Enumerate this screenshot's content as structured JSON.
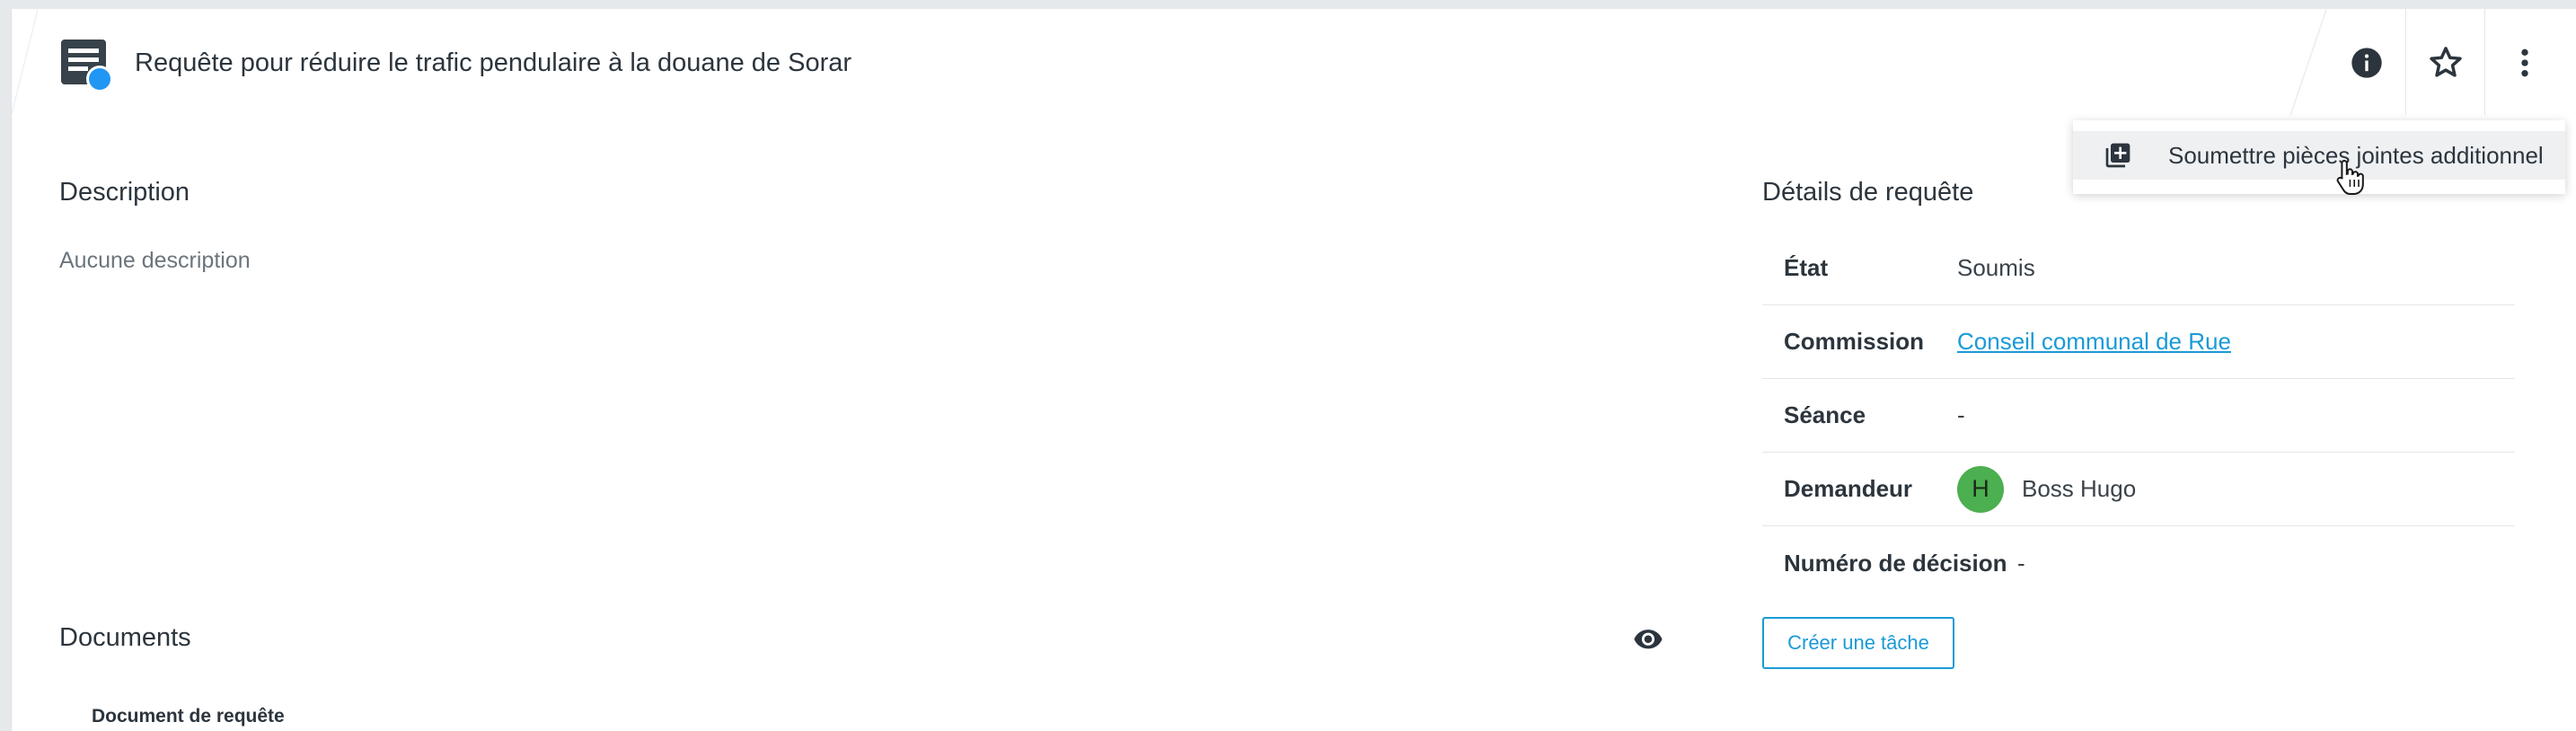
{
  "header": {
    "title": "Requête pour réduire le trafic pendulaire à la douane de Sorar",
    "icons": [
      "request-document-icon",
      "info-icon",
      "star-icon",
      "more-vertical-icon"
    ]
  },
  "menu": {
    "items": [
      {
        "label": "Soumettre pièces jointes additionnel",
        "icon": "add-attachment-icon"
      }
    ]
  },
  "description": {
    "title": "Description",
    "empty_text": "Aucune description"
  },
  "details": {
    "title": "Détails de requête",
    "rows": [
      {
        "label": "État",
        "value": "Soumis"
      },
      {
        "label": "Commission",
        "value": "Conseil communal de Rue"
      },
      {
        "label": "Séance",
        "value": "-"
      },
      {
        "label": "Demandeur",
        "value": "Boss Hugo",
        "avatar_initial": "H"
      },
      {
        "label": "Numéro de décision",
        "value": "-"
      }
    ],
    "create_task_label": "Créer une tâche"
  },
  "documents": {
    "title": "Documents",
    "subtitle": "Document de requête"
  },
  "colors": {
    "accent": "#1a9ad6",
    "badge_blue": "#2196f3",
    "avatar_green": "#4caf50",
    "text_dark": "#2c353d",
    "background": "#e6e9ec"
  }
}
